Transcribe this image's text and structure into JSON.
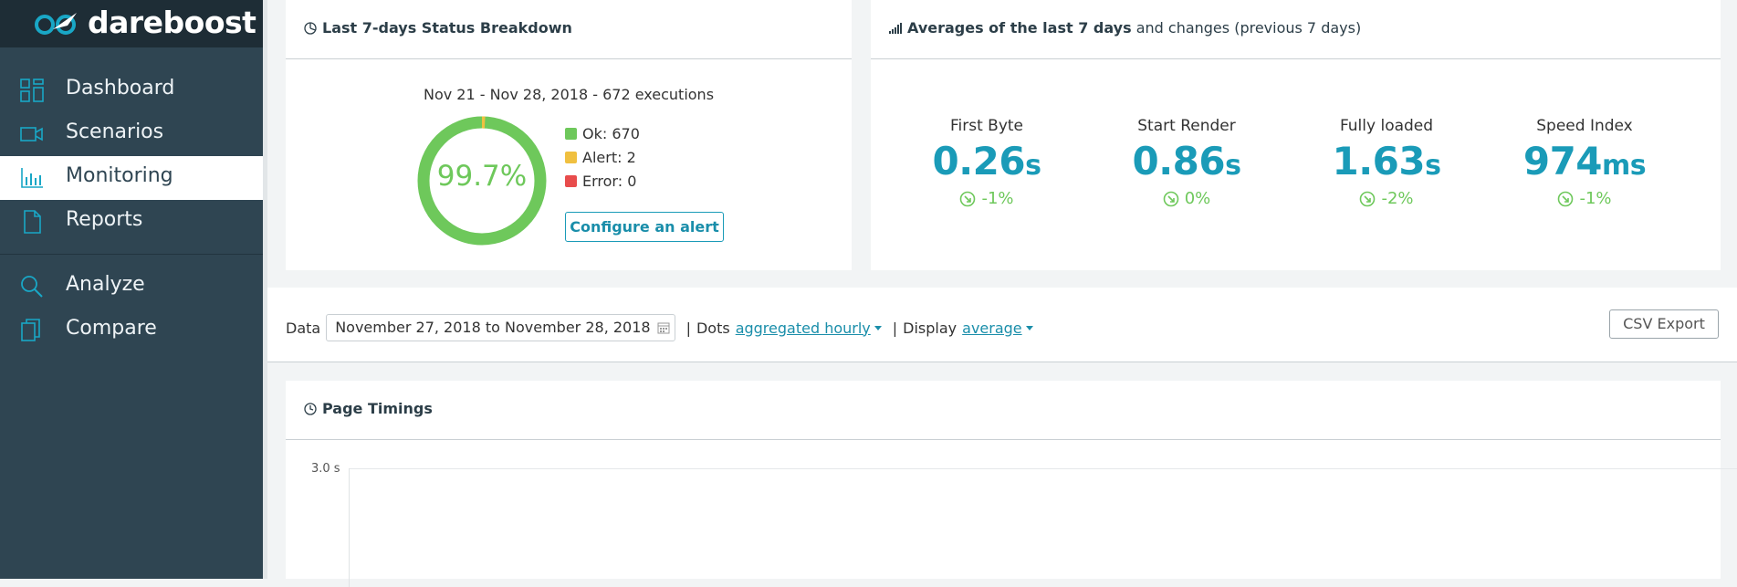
{
  "brand": {
    "name": "dareboost"
  },
  "sidebar": {
    "items": [
      {
        "label": "Dashboard",
        "icon": "dashboard-grid-icon"
      },
      {
        "label": "Scenarios",
        "icon": "video-camera-icon"
      },
      {
        "label": "Monitoring",
        "icon": "bar-chart-icon",
        "active": true
      },
      {
        "label": "Reports",
        "icon": "document-icon"
      },
      {
        "label": "Analyze",
        "icon": "search-icon"
      },
      {
        "label": "Compare",
        "icon": "copy-pages-icon"
      }
    ]
  },
  "status_card": {
    "title": "Last 7-days Status Breakdown",
    "icon": "pie-chart-icon",
    "range": "Nov 21 - Nov 28, 2018 - 672 executions",
    "percent": "99.7%",
    "breakdown": {
      "ok": 670,
      "alert": 2,
      "error": 0
    },
    "legend": [
      {
        "label": "Ok: 670",
        "color": "#6ec85b"
      },
      {
        "label": "Alert: 2",
        "color": "#f0c040"
      },
      {
        "label": "Error: 0",
        "color": "#e84c4c"
      }
    ],
    "configure_button": "Configure an alert"
  },
  "averages_card": {
    "title_bold": "Averages of the last 7 days",
    "title_rest": "and changes (previous 7 days)",
    "icon": "signal-bars-icon",
    "metrics": [
      {
        "label": "First Byte",
        "value": "0.26",
        "unit": "s",
        "change": "-1%"
      },
      {
        "label": "Start Render",
        "value": "0.86",
        "unit": "s",
        "change": "0%"
      },
      {
        "label": "Fully loaded",
        "value": "1.63",
        "unit": "s",
        "change": "-2%"
      },
      {
        "label": "Speed Index",
        "value": "974",
        "unit": "ms",
        "change": "-1%"
      }
    ]
  },
  "filter": {
    "data_label": "Data",
    "date_range": "November 27, 2018 to November 28, 2018",
    "sep1": "|",
    "dots_label": "Dots",
    "dots_value": "aggregated hourly",
    "sep2": "|",
    "display_label": "Display",
    "display_value": "average",
    "csv_button": "CSV Export"
  },
  "timings_card": {
    "title": "Page Timings",
    "icon": "clock-icon",
    "y_tick_top": "3.0 s"
  },
  "colors": {
    "accent": "#1a9bb8",
    "ok": "#6ec85b",
    "alert": "#f0c040",
    "error": "#e84c4c",
    "sidebar": "#2f4552"
  }
}
